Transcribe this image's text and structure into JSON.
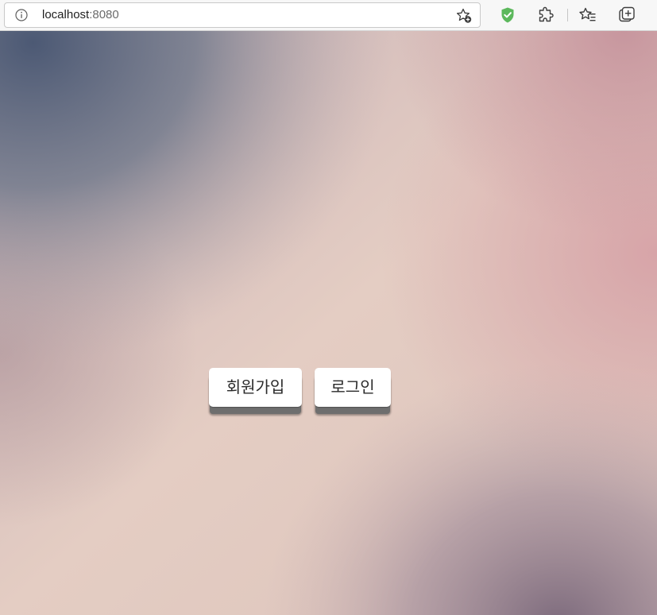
{
  "browser": {
    "url_host": "localhost",
    "url_port": ":8080",
    "icons": {
      "site_info": "info-icon",
      "add_favorite": "star-plus-icon",
      "shield": "shield-check-icon",
      "extensions": "puzzle-icon",
      "favorites": "favorites-list-icon",
      "collections": "collections-icon"
    },
    "colors": {
      "shield": "#5cb85c"
    }
  },
  "page": {
    "buttons": {
      "signup_label": "회원가입",
      "login_label": "로그인"
    }
  }
}
